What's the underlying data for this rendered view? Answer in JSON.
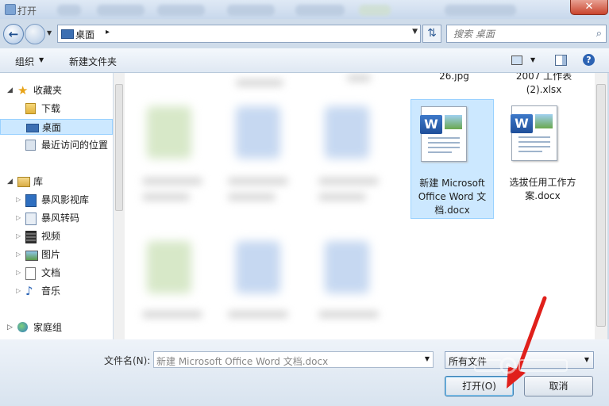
{
  "window": {
    "title": "打开",
    "close_glyph": "✕"
  },
  "address": {
    "location": "桌面",
    "arrow": "▸",
    "search_placeholder": "搜索 桌面"
  },
  "toolbar": {
    "organize_label": "组织",
    "new_folder_label": "新建文件夹",
    "help_glyph": "?"
  },
  "nav": {
    "favorites": {
      "label": "收藏夹",
      "items": [
        "下载",
        "桌面",
        "最近访问的位置"
      ]
    },
    "library": {
      "label": "库",
      "items": [
        "暴风影视库",
        "暴风转码",
        "视频",
        "图片",
        "文档",
        "音乐"
      ]
    },
    "homegroup": {
      "label": "家庭组"
    }
  },
  "files": {
    "partial_top": [
      "26.jpg",
      "2007 工作表\n(2).xlsx"
    ],
    "items": [
      {
        "name": "新建 Microsoft Office Word 文档.docx",
        "selected": true
      },
      {
        "name": "选拔任用工作方案.docx",
        "selected": false
      }
    ]
  },
  "bottom": {
    "filename_label": "文件名(N):",
    "filename_value": "新建 Microsoft Office Word 文档.docx",
    "filetype_value": "所有文件",
    "open_label": "打开(O)",
    "cancel_label": "取消"
  },
  "colors": {
    "selection": "#cce8ff",
    "annotation_arrow": "#e0201b"
  }
}
